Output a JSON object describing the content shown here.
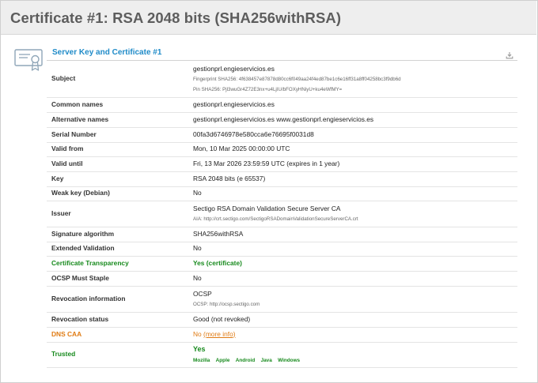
{
  "page": {
    "title": "Certificate #1: RSA 2048 bits (SHA256withRSA)"
  },
  "section": {
    "title": "Server Key and Certificate #1",
    "download_icon": "download-icon",
    "certificate_icon": "certificate-icon"
  },
  "rows": {
    "subject": {
      "label": "Subject",
      "value": "gestionprl.engieservicios.es",
      "fingerprint": "Fingerprint SHA256: 4f638457e87878d80cc6f049aa24f4ed87be1c6e16ff31a8ff04258bc3f9db6d",
      "pin": "Pin SHA256: Pjl3wuGr4Z72E3nx+u4LjIU/bFOXyHNiyU+ku4eWfMY="
    },
    "common_names": {
      "label": "Common names",
      "value": "gestionprl.engieservicios.es"
    },
    "alternative_names": {
      "label": "Alternative names",
      "value": "gestionprl.engieservicios.es www.gestionprl.engieservicios.es"
    },
    "serial_number": {
      "label": "Serial Number",
      "value": "00fa3d6746978e580cca6e76695f0031d8"
    },
    "valid_from": {
      "label": "Valid from",
      "value": "Mon, 10 Mar 2025 00:00:00 UTC"
    },
    "valid_until": {
      "label": "Valid until",
      "value": "Fri, 13 Mar 2026 23:59:59 UTC (expires in 1 year)"
    },
    "key": {
      "label": "Key",
      "value": "RSA 2048 bits (e 65537)"
    },
    "weak_key": {
      "label": "Weak key (Debian)",
      "value": "No"
    },
    "issuer": {
      "label": "Issuer",
      "value": "Sectigo RSA Domain Validation Secure Server CA",
      "aia": "AIA: http://crt.sectigo.com/SectigoRSADomainValidationSecureServerCA.crt"
    },
    "signature_algorithm": {
      "label": "Signature algorithm",
      "value": "SHA256withRSA"
    },
    "extended_validation": {
      "label": "Extended Validation",
      "value": "No"
    },
    "certificate_transparency": {
      "label": "Certificate Transparency",
      "value": "Yes (certificate)"
    },
    "ocsp_must_staple": {
      "label": "OCSP Must Staple",
      "value": "No"
    },
    "revocation_information": {
      "label": "Revocation information",
      "value": "OCSP",
      "ocsp": "OCSP: http://ocsp.sectigo.com"
    },
    "revocation_status": {
      "label": "Revocation status",
      "value": "Good (not revoked)"
    },
    "dns_caa": {
      "label": "DNS CAA",
      "value": "No",
      "link": "(more info)"
    },
    "trusted": {
      "label": "Trusted",
      "value": "Yes",
      "platforms": [
        "Mozilla",
        "Apple",
        "Android",
        "Java",
        "Windows"
      ]
    }
  },
  "colors": {
    "section_title": "#1f8bc8",
    "good_green": "#178a1d",
    "warning_orange": "#e07b13",
    "title_bar_bg": "#eeeeee"
  }
}
